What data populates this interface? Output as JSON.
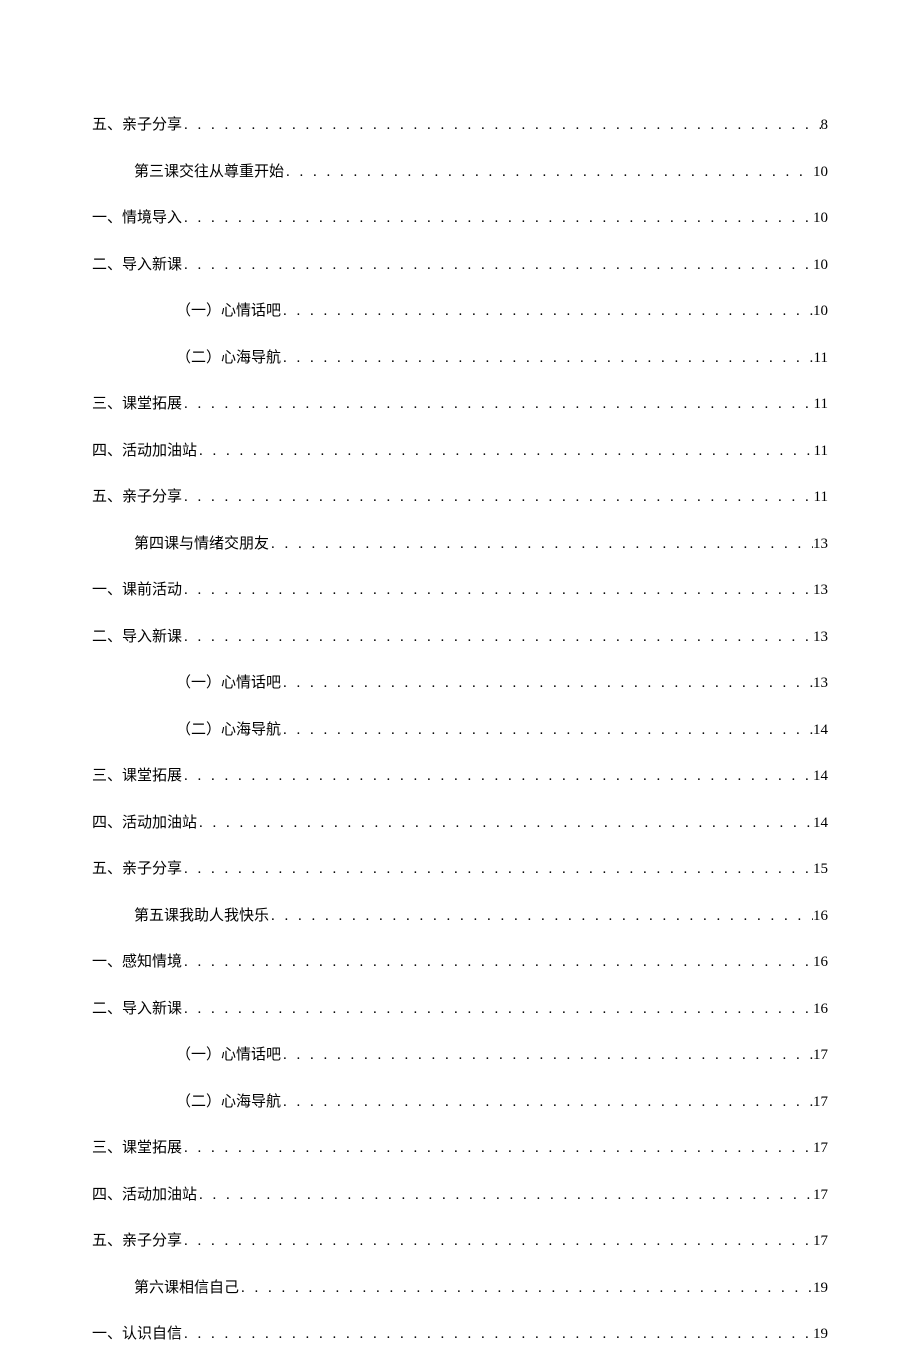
{
  "toc": [
    {
      "level": 0,
      "label": "五、亲子分享",
      "page": "8"
    },
    {
      "level": 1,
      "label": "第三课交往从尊重开始",
      "page": "10"
    },
    {
      "level": 0,
      "label": "一、情境导入",
      "page": "10"
    },
    {
      "level": 0,
      "label": "二、导入新课",
      "page": "10"
    },
    {
      "level": 2,
      "label": "（一）心情话吧",
      "page": "10"
    },
    {
      "level": 2,
      "label": "（二）心海导航",
      "page": "11"
    },
    {
      "level": 0,
      "label": "三、课堂拓展",
      "page": "11"
    },
    {
      "level": 0,
      "label": "四、活动加油站",
      "page": "11"
    },
    {
      "level": 0,
      "label": "五、亲子分享",
      "page": "11"
    },
    {
      "level": 1,
      "label": "第四课与情绪交朋友",
      "page": "13"
    },
    {
      "level": 0,
      "label": "一、课前活动",
      "page": "13"
    },
    {
      "level": 0,
      "label": "二、导入新课",
      "page": "13"
    },
    {
      "level": 2,
      "label": "（一）心情话吧",
      "page": "13"
    },
    {
      "level": 2,
      "label": "（二）心海导航",
      "page": "14"
    },
    {
      "level": 0,
      "label": "三、课堂拓展",
      "page": "14"
    },
    {
      "level": 0,
      "label": "四、活动加油站",
      "page": "14"
    },
    {
      "level": 0,
      "label": "五、亲子分享",
      "page": "15"
    },
    {
      "level": 1,
      "label": "第五课我助人我快乐",
      "page": "16"
    },
    {
      "level": 0,
      "label": "一、感知情境",
      "page": "16"
    },
    {
      "level": 0,
      "label": "二、导入新课",
      "page": "16"
    },
    {
      "level": 2,
      "label": "（一）心情话吧",
      "page": "17"
    },
    {
      "level": 2,
      "label": "（二）心海导航",
      "page": "17"
    },
    {
      "level": 0,
      "label": "三、课堂拓展",
      "page": "17"
    },
    {
      "level": 0,
      "label": "四、活动加油站",
      "page": "17"
    },
    {
      "level": 0,
      "label": "五、亲子分享",
      "page": "17"
    },
    {
      "level": 1,
      "label": "第六课相信自己",
      "page": "19"
    },
    {
      "level": 0,
      "label": "一、认识自信",
      "page": "19"
    }
  ],
  "dot_fill": ". . . . . . . . . . . . . . . . . . . . . . . . . . . . . . . . . . . . . . . . . . . . . . . . . . . . . . . . . . . . . . . . . . . . . . . . . . . . . . . . . . . . . . . . . . . . . . . . . . . . . . . . . . . . . . . . . . . . . . . ."
}
